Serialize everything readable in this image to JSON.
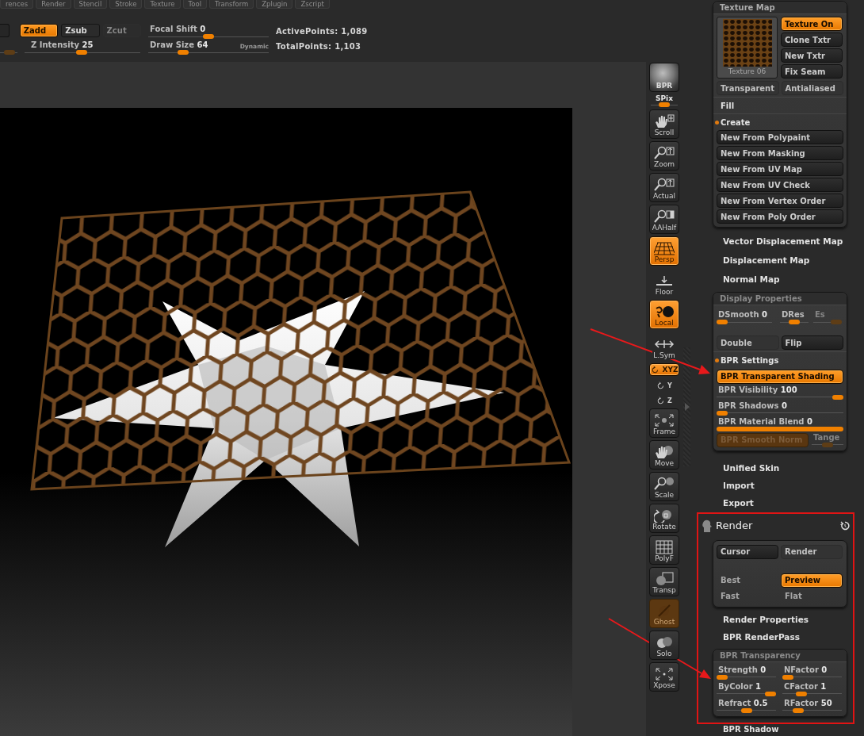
{
  "menu_bar": {
    "items": [
      "rences",
      "Render",
      "Stencil",
      "Stroke",
      "Texture",
      "Tool",
      "Transform",
      "Zplugin",
      "Zscript"
    ]
  },
  "top_toolbar": {
    "draw_modes": [
      {
        "label": "Zadd",
        "selected": true,
        "disabled": false
      },
      {
        "label": "Zsub",
        "selected": false,
        "disabled": false
      },
      {
        "label": "Zcut",
        "selected": false,
        "disabled": true
      }
    ],
    "partial_slider": {
      "level": 0.6,
      "disabled": true
    },
    "sliders": [
      {
        "label": "Z Intensity",
        "value": "25",
        "level": 0.49
      },
      {
        "label": "Focal Shift",
        "value": "0",
        "level": 0.5
      },
      {
        "label": "Draw Size",
        "value": "64",
        "level": 0.27,
        "option": "Dynamic"
      }
    ],
    "stats": [
      "ActivePoints: 1,089",
      "TotalPoints: 1,103"
    ]
  },
  "side_toolbar": {
    "items": [
      {
        "kind": "sphere",
        "label": "BPR",
        "on": false,
        "disabled": false
      },
      {
        "kind": "slider",
        "label": "SPix",
        "level": 0.5
      },
      {
        "kind": "button",
        "label": "Scroll",
        "on": false,
        "disabled": false
      },
      {
        "kind": "button",
        "label": "Zoom",
        "on": false,
        "disabled": false
      },
      {
        "kind": "button",
        "label": "Actual",
        "on": false,
        "disabled": false
      },
      {
        "kind": "button",
        "label": "AAHalf",
        "on": false,
        "disabled": false
      },
      {
        "kind": "button",
        "label": "Persp",
        "on": true,
        "disabled": false
      },
      {
        "kind": "plain",
        "label": "Floor",
        "on": false,
        "disabled": false
      },
      {
        "kind": "button",
        "label": "Local",
        "on": true,
        "disabled": false
      },
      {
        "kind": "plain",
        "label": "L.Sym",
        "on": false,
        "disabled": false
      },
      {
        "kind": "small",
        "label": "XYZ",
        "on": true,
        "disabled": false
      },
      {
        "kind": "axis",
        "label": "Y",
        "on": false,
        "disabled": false
      },
      {
        "kind": "axis",
        "label": "Z",
        "on": false,
        "disabled": false
      },
      {
        "kind": "button",
        "label": "Frame",
        "on": false,
        "disabled": false
      },
      {
        "kind": "button",
        "label": "Move",
        "on": false,
        "disabled": false
      },
      {
        "kind": "button",
        "label": "Scale",
        "on": false,
        "disabled": false
      },
      {
        "kind": "button",
        "label": "Rotate",
        "on": false,
        "disabled": false
      },
      {
        "kind": "button",
        "label": "PolyF",
        "on": false,
        "disabled": false
      },
      {
        "kind": "button",
        "label": "Transp",
        "on": false,
        "disabled": false
      },
      {
        "kind": "button",
        "label": "Ghost",
        "on": true,
        "disabled": true
      },
      {
        "kind": "button",
        "label": "Solo",
        "on": false,
        "disabled": false
      },
      {
        "kind": "button",
        "label": "Xpose",
        "on": false,
        "disabled": false
      }
    ]
  },
  "right_panel": {
    "texture_map": {
      "title": "Texture Map",
      "thumbnail_label": "Texture 06",
      "buttons": [
        {
          "label": "Texture On",
          "on": true
        },
        {
          "label": "Clone Txtr",
          "on": false
        },
        {
          "label": "New Txtr",
          "on": false
        },
        {
          "label": "Fix Seam",
          "on": false
        }
      ],
      "options": [
        {
          "label": "Transparent",
          "on": false
        },
        {
          "label": "Antialiased",
          "on": false
        }
      ],
      "fill": {
        "label": "Fill",
        "expanded": false
      },
      "create": {
        "label": "Create",
        "expanded": true
      },
      "create_buttons": [
        "New From Polypaint",
        "New From Masking",
        "New From UV Map",
        "New From UV Check",
        "New From Vertex Order",
        "New From Poly Order"
      ]
    },
    "subpalettes": [
      "Vector Displacement Map",
      "Displacement Map",
      "Normal Map"
    ],
    "display_properties": {
      "title": "Display Properties",
      "sliders": [
        {
          "label": "DSmooth",
          "value": "0",
          "level": 0,
          "disabled": false
        },
        {
          "label": "DRes",
          "level": 0.5,
          "disabled": false
        },
        {
          "label": "Es",
          "level": 1,
          "disabled": true
        }
      ],
      "toggles": [
        {
          "label": "Double",
          "kind": "flat"
        },
        {
          "label": "Flip",
          "kind": "framed"
        }
      ],
      "bpr_settings": {
        "label": "BPR Settings",
        "expanded": true
      },
      "rows": [
        {
          "kind": "toggle",
          "label": "BPR Transparent Shading",
          "on": true
        },
        {
          "kind": "slider",
          "label": "BPR Visibility",
          "value": "100",
          "level": 1
        },
        {
          "kind": "slider",
          "label": "BPR Shadows",
          "value": "0",
          "level": 0
        },
        {
          "kind": "bar",
          "label": "BPR Material Blend",
          "value": "0",
          "level": 1
        },
        {
          "kind": "split",
          "toggle": {
            "label": "BPR Smooth Norm",
            "on": true,
            "disabled": true
          },
          "slider": {
            "label": "Tange",
            "level": 0.5,
            "disabled": true
          }
        }
      ]
    },
    "subpalettes_2": [
      "Unified Skin",
      "Import",
      "Export"
    ],
    "render": {
      "title": "Render",
      "buttons": [
        {
          "label": "Cursor",
          "kind": "framed"
        },
        {
          "label": "Render",
          "kind": "flat"
        }
      ],
      "quality": [
        {
          "label": "Best",
          "selected": false
        },
        {
          "label": "Preview",
          "selected": true
        },
        {
          "label": "Fast",
          "selected": false
        },
        {
          "label": "Flat",
          "selected": false
        }
      ],
      "subpalettes": [
        "Render Properties",
        "BPR RenderPass"
      ],
      "transparency": {
        "title": "BPR Transparency",
        "sliders": [
          {
            "label": "Strength",
            "value": "0",
            "level": 0
          },
          {
            "label": "NFactor",
            "value": "0",
            "level": 0
          },
          {
            "label": "ByColor",
            "value": "1",
            "level": 1
          },
          {
            "label": "CFactor",
            "value": "1",
            "level": 0.28
          },
          {
            "label": "Refract",
            "value": "0.5",
            "level": 0.5
          },
          {
            "label": "RFactor",
            "value": "50",
            "level": 0.22
          }
        ]
      }
    },
    "next_subpalette": "BPR Shadow"
  }
}
